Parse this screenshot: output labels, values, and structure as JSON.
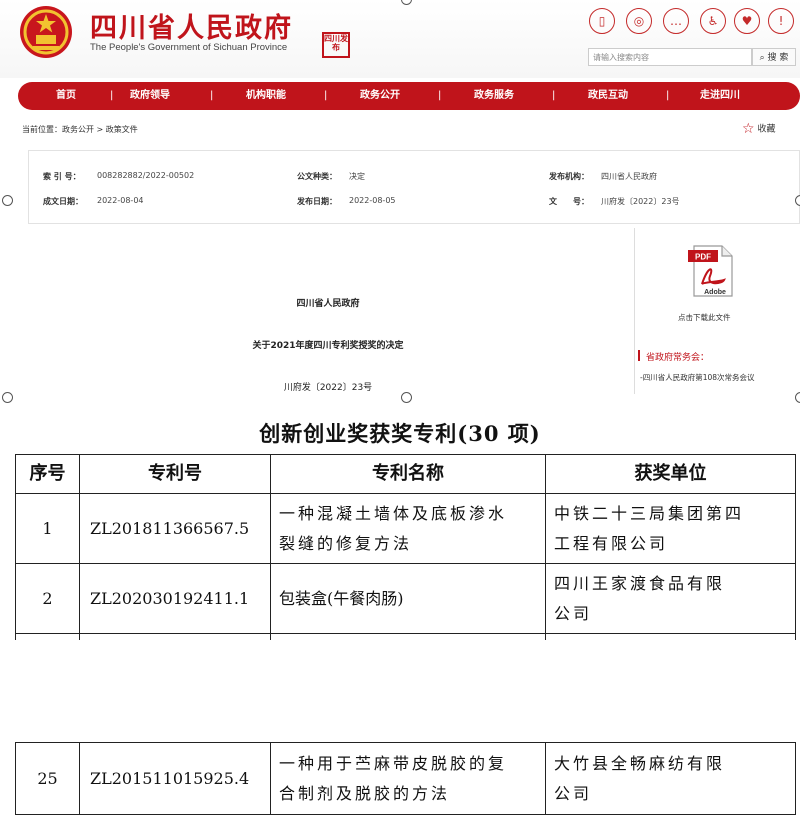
{
  "header": {
    "site_title": "四川省人民政府",
    "site_subtitle": "The People's Government of Sichuan Province",
    "seal_text": "四川发布",
    "top_icons": [
      "mobile-icon",
      "weibo-icon",
      "wechat-icon",
      "accessibility-icon",
      "elderly-care-icon",
      "info-icon"
    ],
    "search_placeholder": "请输入搜索内容",
    "search_button": "搜 索"
  },
  "nav": {
    "items": [
      "首页",
      "政府领导",
      "机构职能",
      "政务公开",
      "政务服务",
      "政民互动",
      "走进四川"
    ]
  },
  "breadcrumb": "当前位置：政务公开 > 政策文件",
  "favorite_label": "收藏",
  "meta": {
    "index_no_label": "索 引 号：",
    "index_no": "008282882/2022-00502",
    "doc_type_label": "公文种类：",
    "doc_type": "决定",
    "issuer_label": "发布机构：",
    "issuer": "四川省人民政府",
    "created_label": "成文日期：",
    "created": "2022-08-04",
    "published_label": "发布日期：",
    "published": "2022-08-05",
    "doc_no_label": "文　　号：",
    "doc_no": "川府发〔2022〕23号"
  },
  "document": {
    "issuer_line": "四川省人民政府",
    "title": "关于2021年度四川专利奖授奖的决定",
    "doc_no": "川府发〔2022〕23号"
  },
  "sidebar": {
    "pdf_label": "PDF",
    "pdf_brand": "Adobe",
    "download_label": "点击下载此文件",
    "meeting_title": "省政府常务会：",
    "meeting_text": "-四川省人民政府第108次常务会议"
  },
  "table": {
    "title": "创新创业奖获奖专利(30 项)",
    "headers": [
      "序号",
      "专利号",
      "专利名称",
      "获奖单位"
    ],
    "rows": [
      {
        "no": "1",
        "patent_no": "ZL201811366567.5",
        "name_lines": [
          "一种混凝土墙体及底板渗水",
          "裂缝的修复方法"
        ],
        "unit_lines": [
          "中铁二十三局集团第四",
          "工程有限公司"
        ]
      },
      {
        "no": "2",
        "patent_no": "ZL202030192411.1",
        "name_lines": [
          "包装盒(午餐肉肠)",
          ""
        ],
        "unit_lines": [
          "四川王家渡食品有限",
          "公司"
        ]
      },
      {
        "no": "25",
        "patent_no": "ZL201511015925.4",
        "name_lines": [
          "一种用于苎麻带皮脱胶的复",
          "合制剂及脱胶的方法"
        ],
        "unit_lines": [
          "大竹县全畅麻纺有限",
          "公司"
        ]
      }
    ]
  },
  "colors": {
    "brand_red": "#c0141b",
    "border": "#222222"
  }
}
